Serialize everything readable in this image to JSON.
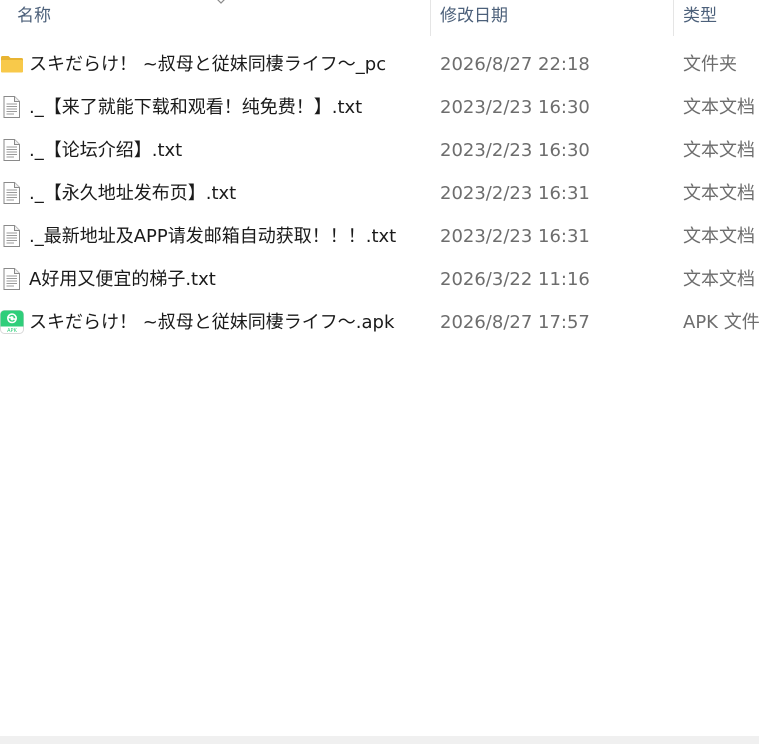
{
  "columns": {
    "name": "名称",
    "modified": "修改日期",
    "type": "类型"
  },
  "files": [
    {
      "name": "スキだらけ！ ~叔母と従妹同棲ライフ～_pc",
      "modified": "2026/8/27 22:18",
      "type": "文件夹",
      "icon": "folder-icon"
    },
    {
      "name": "._【来了就能下载和观看！纯免费！】.txt",
      "modified": "2023/2/23 16:30",
      "type": "文本文档",
      "icon": "text-file-icon"
    },
    {
      "name": "._【论坛介绍】.txt",
      "modified": "2023/2/23 16:30",
      "type": "文本文档",
      "icon": "text-file-icon"
    },
    {
      "name": "._【永久地址发布页】.txt",
      "modified": "2023/2/23 16:31",
      "type": "文本文档",
      "icon": "text-file-icon"
    },
    {
      "name": "._最新地址及APP请发邮箱自动获取！！！.txt",
      "modified": "2023/2/23 16:31",
      "type": "文本文档",
      "icon": "text-file-icon"
    },
    {
      "name": "A好用又便宜的梯子.txt",
      "modified": "2026/3/22 11:16",
      "type": "文本文档",
      "icon": "text-file-icon"
    },
    {
      "name": "スキだらけ！ ~叔母と従妹同棲ライフ～.apk",
      "modified": "2026/8/27 17:57",
      "type": "APK 文件",
      "icon": "apk-file-icon"
    }
  ],
  "apk_icon_label": "APK",
  "colors": {
    "header_text": "#4c607a",
    "name_text": "#1a1a1a",
    "meta_text": "#6d6d6d",
    "folder": "#f8c94a",
    "apk_green": "#2fce7a"
  }
}
